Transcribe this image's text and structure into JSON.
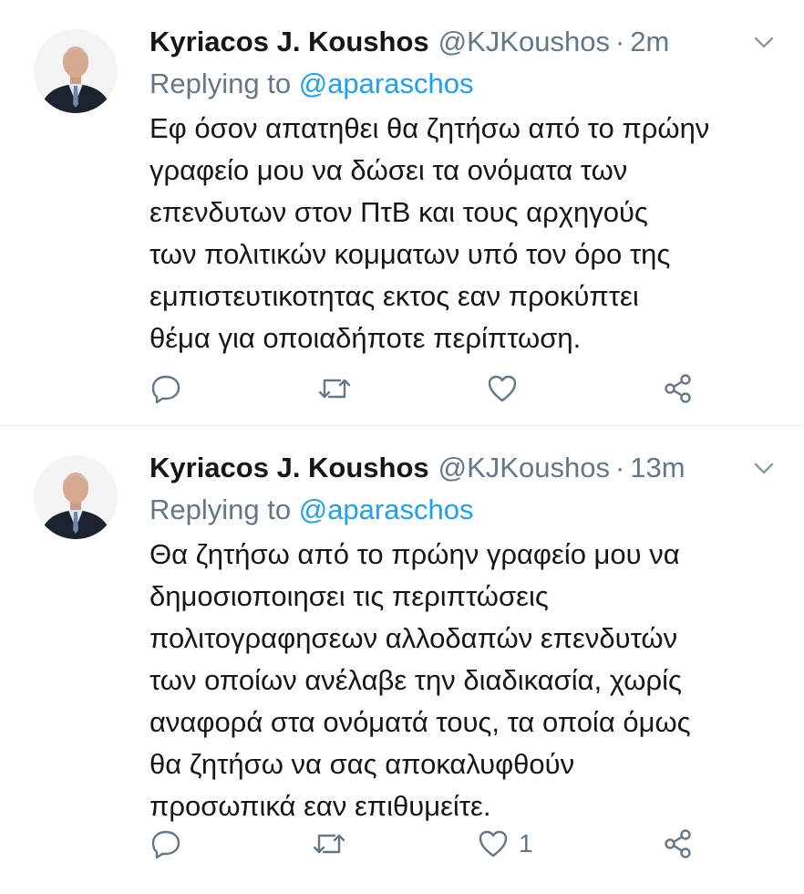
{
  "tweets": [
    {
      "name": "Kyriacos J. Koushos",
      "handle": "@KJKoushos",
      "separator": "·",
      "time": "2m",
      "reply_prefix": "Replying to ",
      "reply_to": "@aparaschos",
      "text": "Εφ όσον απατηθει θα ζητήσω από το πρώην\nγραφείο μου να δώσει τα ονόματα των\nεπενδυτων στον ΠτΒ και τους αρχηγούς\nτων πολιτικών κομματων υπό τον όρο της\nεμπιστευτικοτητας εκτος εαν προκύπτει\nθέμα για οποιαδήποτε περίπτωση.",
      "like_count": ""
    },
    {
      "name": "Kyriacos J. Koushos",
      "handle": "@KJKoushos",
      "separator": "·",
      "time": "13m",
      "reply_prefix": "Replying to ",
      "reply_to": "@aparaschos",
      "text": "Θα ζητήσω από το πρώην γραφείο μου να\nδημοσιοποιησει τις περιπτώσεις\nπολιτογραφησεων αλλοδαπών επενδυτών\nτων οποίων ανέλαβε την διαδικασία, χωρίς\nαναφορά στα ονόματά τους, τα οποία όμως\nθα ζητήσω να σας αποκαλυφθούν\nπροσωπικά εαν επιθυμείτε.",
      "like_count": "1"
    }
  ],
  "icons": {
    "reply": "reply-icon",
    "retweet": "retweet-icon",
    "like": "heart-icon",
    "share": "share-icon",
    "more": "chevron-down-icon"
  },
  "colors": {
    "text": "#14171a",
    "secondary": "#657786",
    "link": "#1da1f2",
    "divider": "#e6ecf0"
  }
}
